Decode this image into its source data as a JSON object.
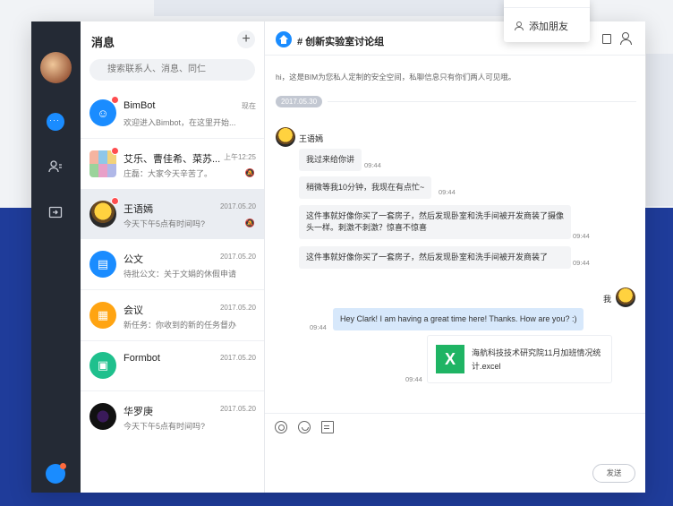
{
  "popup": {
    "add_friend": "添加朋友"
  },
  "list": {
    "title": "消息",
    "add_symbol": "+",
    "search_placeholder": "搜索联系人、消息、同仁",
    "conversations": [
      {
        "name": "BimBot",
        "time": "现在",
        "preview": "欢迎进入Bimbot，在这里开始..."
      },
      {
        "name": "艾乐、曹佳希、菜苏...",
        "time": "上午12:25",
        "preview": "庄磊：大家今天辛苦了。"
      },
      {
        "name": "王语嫣",
        "time": "2017.05.20",
        "preview": "今天下午5点有时间吗?"
      },
      {
        "name": "公文",
        "time": "2017.05.20",
        "preview": "待批公文：关于文娟的休假申请"
      },
      {
        "name": "会议",
        "time": "2017.05.20",
        "preview": "新任务：你收到的新的任务督办"
      },
      {
        "name": "Formbot",
        "time": "2017.05.20",
        "preview": ""
      },
      {
        "name": "华罗庚",
        "time": "2017.05.20",
        "preview": "今天下午5点有时间吗?"
      }
    ]
  },
  "chat": {
    "title": "# 创新实验室讨论组",
    "notice": "hi，这是BIM为您私人定制的安全空间，私聊信息只有你们两人可见哦。",
    "date": "2017.05.30",
    "sender": "王语嫣",
    "messages": [
      {
        "text": "我过来给你讲",
        "time": "09:44"
      },
      {
        "text": "稍微等我10分钟，我现在有点忙~",
        "time": "09:44"
      },
      {
        "text": "这件事就好像你买了一套房子，然后发现卧室和洗手间被开发商装了摄像头一样。刺激不刺激？惊喜不惊喜",
        "time": "09:44"
      },
      {
        "text": "这件事就好像你买了一套房子，然后发现卧室和洗手间被开发商装了",
        "time": "09:44"
      }
    ],
    "me_label": "我",
    "my_message": {
      "text": "Hey Clark! I am having a great time here! Thanks. How are you? :)",
      "time": "09:44"
    },
    "file": {
      "icon_letter": "X",
      "name": "海航科技技术研究院11月加班情况统计.excel",
      "time": "09:44"
    },
    "send_label": "发送"
  },
  "colors": {
    "accent": "#1a8cff",
    "rail": "#242a35",
    "background_band": "#1f3c9a"
  }
}
